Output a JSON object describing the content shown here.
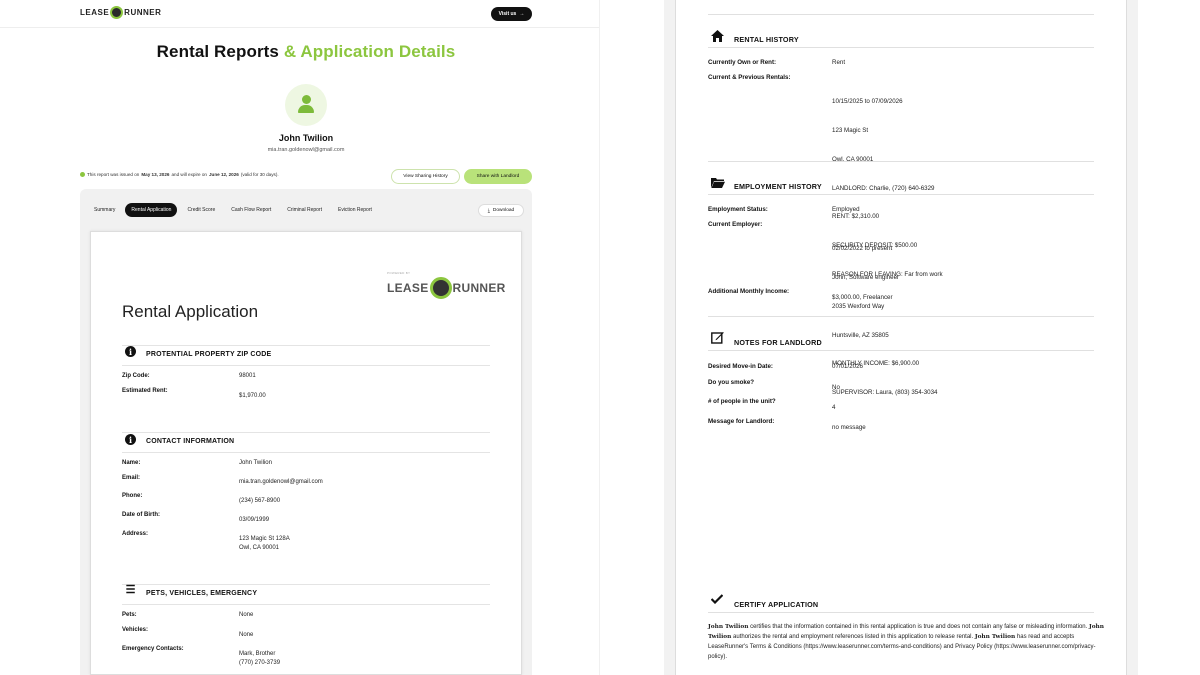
{
  "brand": {
    "logo_left": "LEASE",
    "logo_right": "RUNNER",
    "visit_label": "Visit us",
    "powered_by": "POWERED BY"
  },
  "header": {
    "title_main": "Rental Reports ",
    "title_accent": "& Application Details"
  },
  "user": {
    "name": "John Twilion",
    "email": "mia.tran.goldenowl@gmail.com"
  },
  "report_notice": {
    "prefix": "This report was issued on ",
    "issued_date": "May 13, 2026",
    "middle": " and will expire on ",
    "expire_date": "June 12, 2026",
    "suffix": " (valid for 30 days)."
  },
  "actions": {
    "history_label": "View Sharing History",
    "share_label": "Share with Landlord",
    "download_label": "Download"
  },
  "tabs": [
    "Summary",
    "Rental Application",
    "Credit Score",
    "Cash Flow Report",
    "Criminal Report",
    "Eviction Report"
  ],
  "document": {
    "title": "Rental Application",
    "zip_section": {
      "heading": "PROTENTIAL PROPERTY ZIP CODE",
      "zip_label": "Zip Code:",
      "zip_value": "98001",
      "rent_label": "Estimated Rent:",
      "rent_value": "$1,970.00"
    },
    "contact_section": {
      "heading": "CONTACT INFORMATION",
      "name_label": "Name:",
      "name_value": "John Twilion",
      "email_label": "Email:",
      "email_value": "mia.tran.goldenowl@gmail.com",
      "phone_label": "Phone:",
      "phone_value": "(234) 567-8900",
      "dob_label": "Date of Birth:",
      "dob_value": "03/09/1999",
      "address_label": "Address:",
      "address_line1": "123 Magic St 128A",
      "address_line2": "Owl, CA 90001"
    },
    "pets_section": {
      "heading": "PETS, VEHICLES, EMERGENCY",
      "pets_label": "Pets:",
      "pets_value": "None",
      "vehicles_label": "Vehicles:",
      "vehicles_value": "None",
      "emergency_label": "Emergency Contacts:",
      "emergency_line1": "Mark, Brother",
      "emergency_line2": "(770) 270-3739"
    }
  },
  "pdf": {
    "rental_history": {
      "heading": "RENTAL HISTORY",
      "own_label": "Currently Own or Rent:",
      "own_value": "Rent",
      "rentals_label": "Current & Previous Rentals:",
      "rentals_lines": [
        "10/15/2025 to 07/09/2026",
        "123 Magic St",
        "Owl, CA 90001",
        "LANDLORD: Charlie, (720) 640-6329",
        "RENT: $2,310.00",
        "SECURITY DEPOSIT: $500.00",
        "REASON FOR LEAVING: Far from work"
      ]
    },
    "employment": {
      "heading": "EMPLOYMENT HISTORY",
      "status_label": "Employment Status:",
      "status_value": "Employed",
      "employer_label": "Current Employer:",
      "employer_lines": [
        "02/02/2022 to present",
        "John, Software engineer",
        "2035 Wexford Way",
        "Huntsville, AZ 35805",
        "MONTHLY INCOME: $6,900.00",
        "SUPERVISOR: Laura, (803) 354-3034"
      ],
      "additional_label": "Additional Monthly Income:",
      "additional_value": "$3,000.00, Freelancer"
    },
    "notes": {
      "heading": "NOTES FOR LANDLORD",
      "movein_label": "Desired Move-in Date:",
      "movein_value": "07/01/2026",
      "smoke_label": "Do you smoke?",
      "smoke_value": "No",
      "people_label": "# of people in the unit?",
      "people_value": "4",
      "message_label": "Message for Landlord:",
      "message_value": "no message"
    },
    "certify": {
      "heading": "CERTIFY APPLICATION",
      "name": "John Twilion",
      "text1": " certifies that the information contained in this rental application is true and does not contain any false or misleading information. ",
      "text2": " authorizes the rental and employment references listed in this application to release rental. ",
      "text3": " has read and accepts LeaseRunner's Terms & Conditions (https://www.leaserunner.com/terms-and-conditions) and Privacy Policy (https://www.leaserunner.com/privacy-policy)."
    }
  },
  "colors": {
    "accent": "#8cc63f",
    "dark": "#111111"
  }
}
